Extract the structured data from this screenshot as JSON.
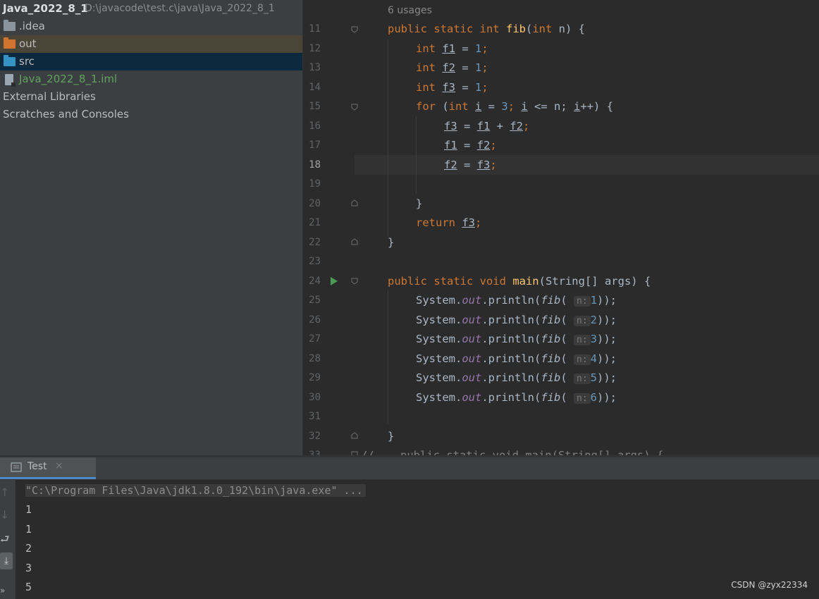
{
  "project": {
    "root_name": "Java_2022_8_1",
    "root_path": "D:\\javacode\\test.c\\java\\Java_2022_8_1",
    "items": [
      {
        "label": ".idea",
        "icon": "folder-icon"
      },
      {
        "label": "out",
        "icon": "folder-excluded-icon"
      },
      {
        "label": "src",
        "icon": "source-folder-icon"
      },
      {
        "label": "Java_2022_8_1.iml",
        "icon": "iml-file-icon"
      },
      {
        "label": "External Libraries",
        "icon": "library-icon"
      },
      {
        "label": "Scratches and Consoles",
        "icon": "scratches-icon"
      }
    ]
  },
  "editor": {
    "usages_hint": "6 usages",
    "current_line": "18",
    "line_numbers": [
      "11",
      "12",
      "13",
      "14",
      "15",
      "16",
      "17",
      "18",
      "19",
      "20",
      "21",
      "22",
      "23",
      "24",
      "25",
      "26",
      "27",
      "28",
      "29",
      "30",
      "31",
      "32",
      "33"
    ],
    "code": {
      "l11": {
        "kw": "public static int ",
        "fn": "fib",
        "rest1": "(",
        "kw2": "int",
        "rest2": " n) {"
      },
      "l12": {
        "kw": "int ",
        "var": "f1",
        "op": " = ",
        "num": "1",
        "end": ";"
      },
      "l13": {
        "kw": "int ",
        "var": "f2",
        "op": " = ",
        "num": "1",
        "end": ";"
      },
      "l14": {
        "kw": "int ",
        "var": "f3",
        "op": " = ",
        "num": "1",
        "end": ";"
      },
      "l15": {
        "kw": "for ",
        "p1": "(",
        "kw2": "int ",
        "v1": "i",
        "p2": " = ",
        "n1": "3",
        "p3": "; ",
        "v2": "i",
        "p4": " <= n; ",
        "v3": "i",
        "p5": "++) {"
      },
      "l16": {
        "v1": "f3",
        "op": " = ",
        "v2": "f1",
        "op2": " + ",
        "v3": "f2",
        "end": ";"
      },
      "l17": {
        "v1": "f1",
        "op": " = ",
        "v2": "f2",
        "end": ";"
      },
      "l18": {
        "v1": "f2",
        "op": " = ",
        "v2": "f3",
        "end": ";"
      },
      "l20": "}",
      "l21": {
        "kw": "return ",
        "var": "f3",
        "end": ";"
      },
      "l22": "}",
      "l24": {
        "kw": "public static void ",
        "fn": "main",
        "rest": "(String[] args) {"
      },
      "println_prefix": "System.",
      "println_out": "out",
      "println_call": ".println(",
      "println_fib": "fib",
      "println_hint": "n:",
      "println_close": "));",
      "println_args": [
        "1",
        "2",
        "3",
        "4",
        "5",
        "6"
      ],
      "l32": "}",
      "l33": "//    public static void main(String[] args) {"
    }
  },
  "run": {
    "tab_label": "Test",
    "command": "\"C:\\Program Files\\Java\\jdk1.8.0_192\\bin\\java.exe\" ...",
    "output": [
      "1",
      "1",
      "2",
      "3",
      "5"
    ]
  },
  "watermark": "CSDN @zyx22334",
  "colors": {
    "keyword": "#cc7832",
    "number": "#6897bb",
    "function": "#ffc66d",
    "static_field": "#9876aa",
    "run_arrow": "#499c54"
  }
}
